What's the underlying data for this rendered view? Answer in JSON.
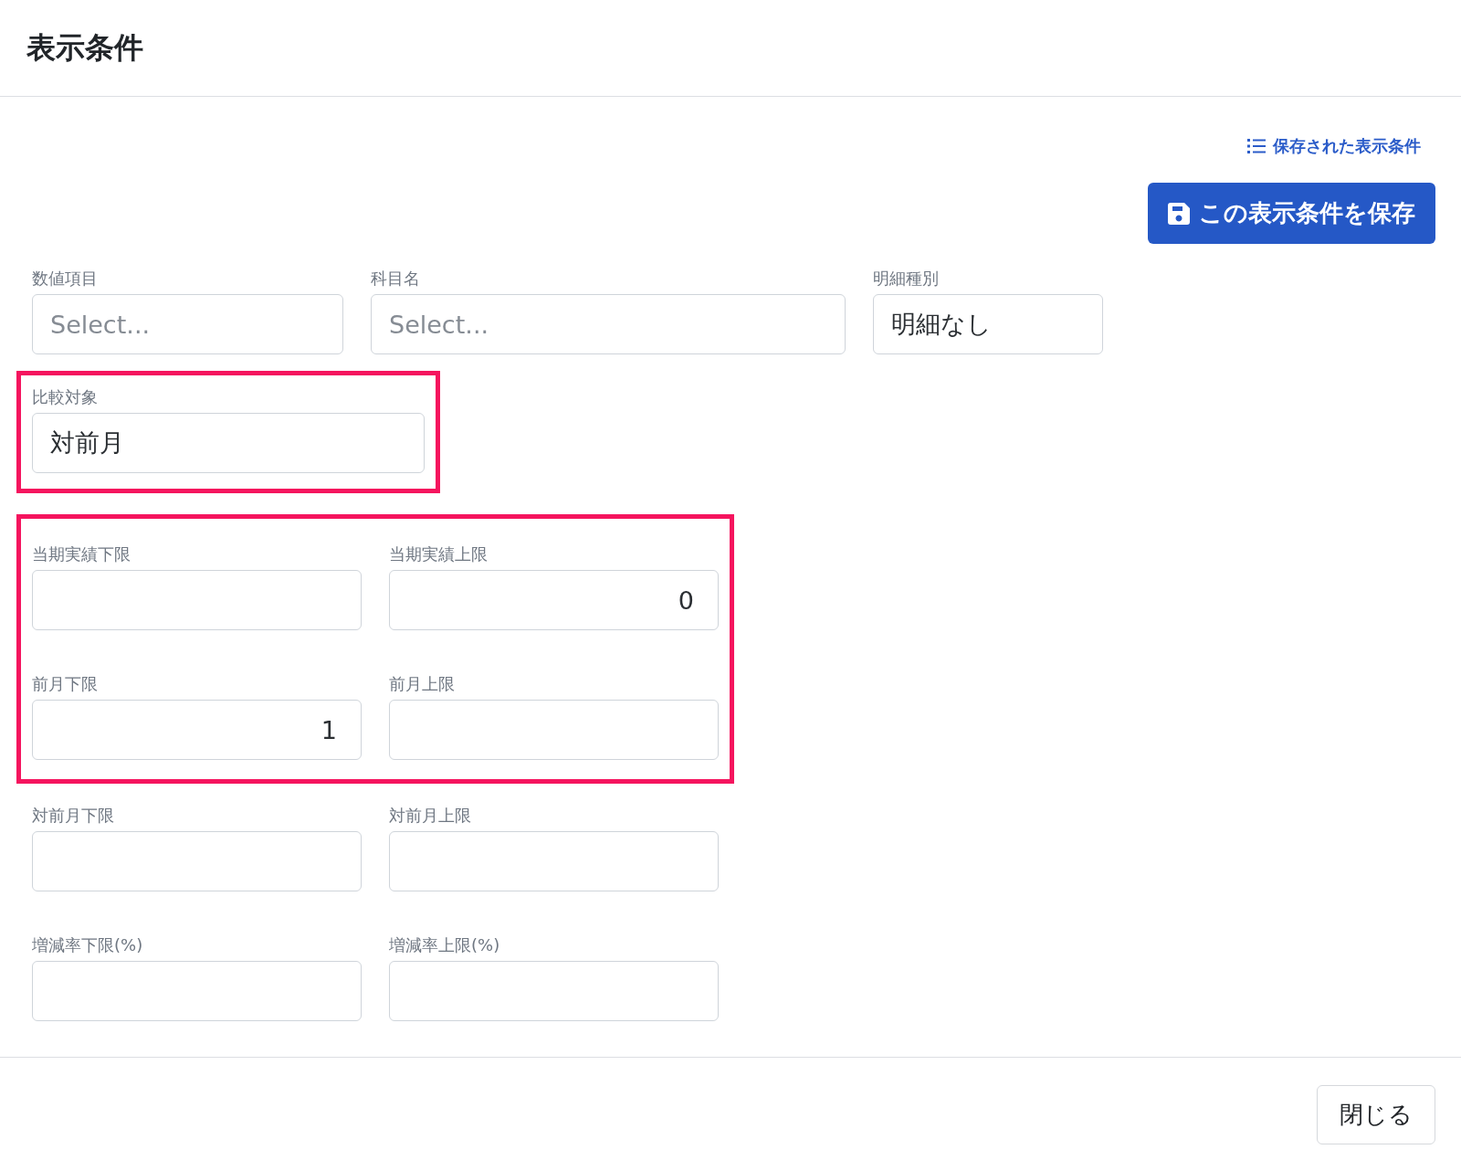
{
  "dialog": {
    "title": "表示条件"
  },
  "actions": {
    "saved_conditions_link": "保存された表示条件",
    "save_button": "この表示条件を保存"
  },
  "sections": [
    {
      "kind": "row",
      "highlighted": false,
      "fields": [
        {
          "label": "数値項目",
          "kind": "select",
          "placeholder": "Select..."
        },
        {
          "label": "科目名",
          "kind": "select",
          "placeholder": "Select..."
        },
        {
          "label": "明細種別",
          "kind": "select",
          "value": "明細なし"
        }
      ]
    },
    {
      "kind": "single",
      "highlighted": true,
      "fields": [
        {
          "label": "比較対象",
          "kind": "select",
          "value": "対前月"
        }
      ]
    },
    {
      "kind": "grid",
      "highlighted": true,
      "fields": [
        {
          "label": "当期実績下限",
          "kind": "number"
        },
        {
          "label": "当期実績上限",
          "kind": "number",
          "value": "0"
        },
        {
          "label": "前月下限",
          "kind": "number",
          "value": "1"
        },
        {
          "label": "前月上限",
          "kind": "number"
        }
      ]
    },
    {
      "kind": "grid",
      "highlighted": false,
      "fields": [
        {
          "label": "対前月下限",
          "kind": "number"
        },
        {
          "label": "対前月上限",
          "kind": "number"
        },
        {
          "label": "増減率下限(%)",
          "kind": "number"
        },
        {
          "label": "増減率上限(%)",
          "kind": "number"
        }
      ]
    }
  ],
  "footer": {
    "close_button": "閉じる"
  }
}
